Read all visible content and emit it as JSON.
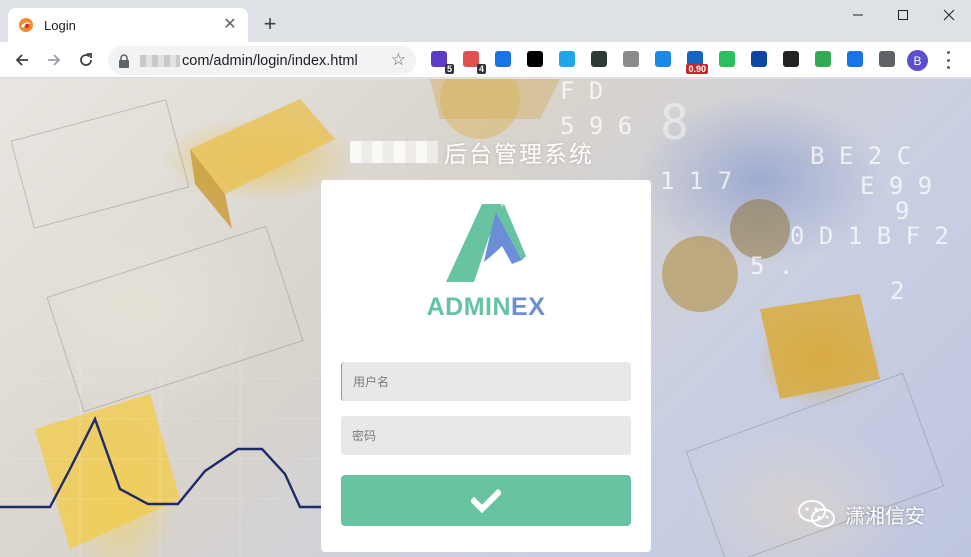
{
  "browser": {
    "tab_title": "Login",
    "url": "com/admin/login/index.html",
    "extensions": [
      {
        "name": "extension-purple-icon",
        "badge": "5",
        "color": "#5b3cc4"
      },
      {
        "name": "extension-link-icon",
        "badge": "4",
        "color": "#e05252"
      },
      {
        "name": "extension-pin-icon",
        "badge": "",
        "color": "#1a73e8"
      },
      {
        "name": "extension-ring-icon",
        "badge": "",
        "color": "#000000"
      },
      {
        "name": "extension-cube-icon",
        "badge": "",
        "color": "#1ea7e8"
      },
      {
        "name": "extension-dark-square-icon",
        "badge": "",
        "color": "#2d3b36"
      },
      {
        "name": "extension-mail-icon",
        "badge": "",
        "color": "#8a8a8a"
      },
      {
        "name": "extension-send-icon",
        "badge": "",
        "color": "#1e88e5"
      },
      {
        "name": "extension-chart-icon",
        "badge": "0.90",
        "color": "#1565c0"
      },
      {
        "name": "extension-evernote-icon",
        "badge": "",
        "color": "#2dbe60"
      },
      {
        "name": "extension-bars-icon",
        "badge": "",
        "color": "#0d47a1"
      },
      {
        "name": "extension-glasses-icon",
        "badge": "",
        "color": "#222222"
      },
      {
        "name": "extension-download-icon",
        "badge": "",
        "color": "#34a853"
      },
      {
        "name": "extension-grid-icon",
        "badge": "",
        "color": "#1a73e8"
      },
      {
        "name": "extension-puzzle-icon",
        "badge": "",
        "color": "#5f6368"
      }
    ],
    "avatar_letter": "B"
  },
  "page": {
    "site_title": "后台管理系统",
    "brand_part1": "ADMIN",
    "brand_part2": "EX",
    "username_placeholder": "用户名",
    "password_placeholder": "密码",
    "watermark": "潇湘信安"
  },
  "colors": {
    "accent": "#68c3a0",
    "brand_blue": "#6b8fd6"
  }
}
